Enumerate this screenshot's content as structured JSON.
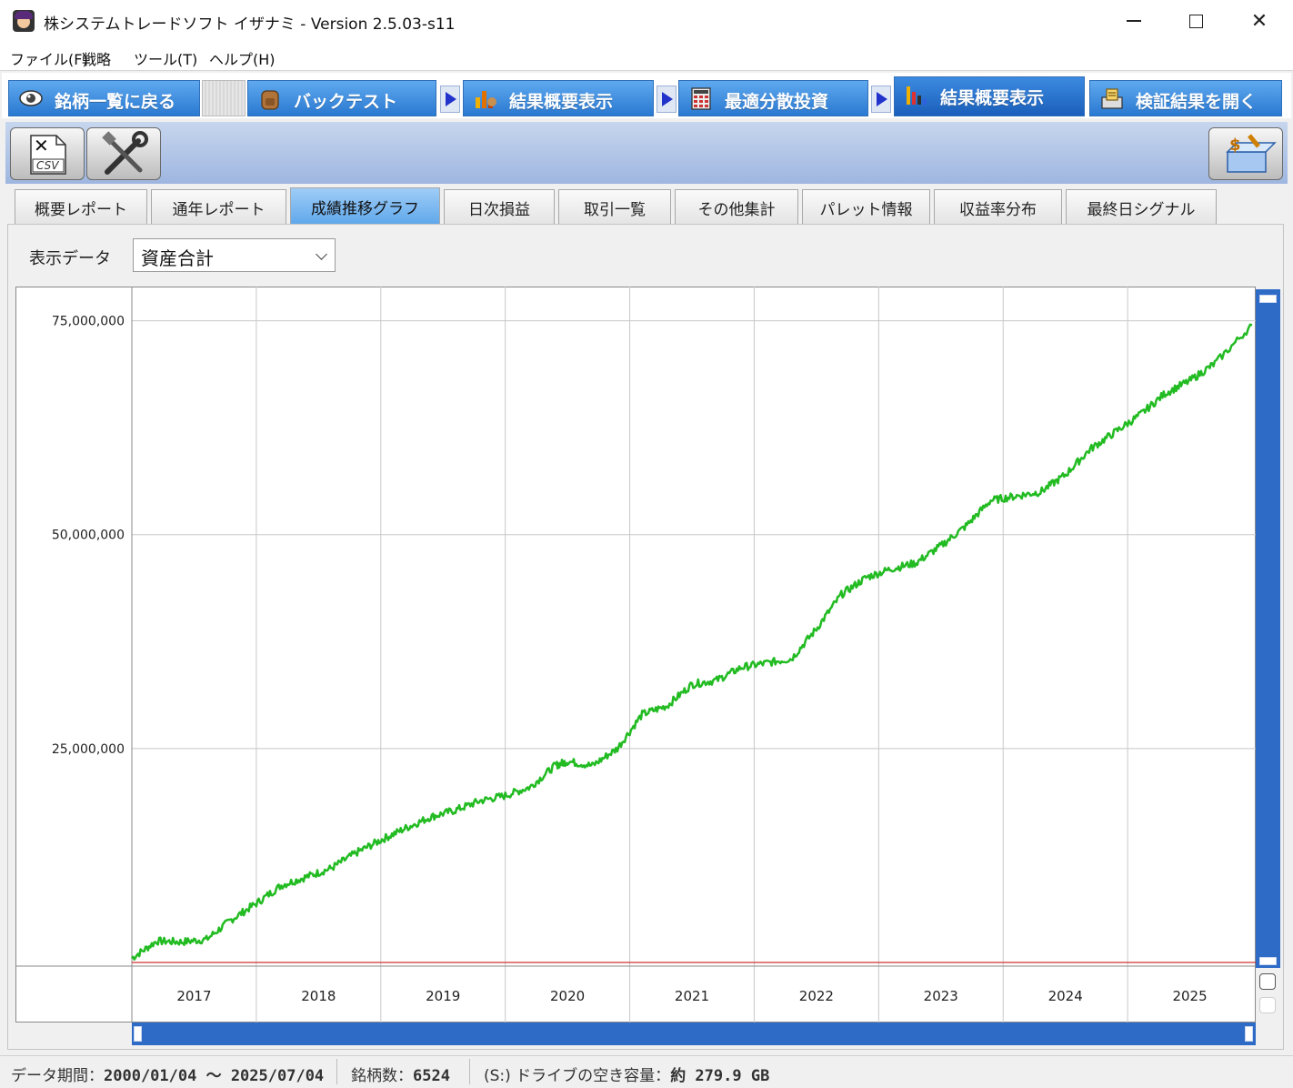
{
  "window": {
    "title": "株システムトレードソフト イザナミ - Version 2.5.03-s11"
  },
  "menu": [
    "ファイル(F)",
    "戦略",
    "ツール(T)",
    "ヘルプ(H)"
  ],
  "main_tabs": [
    {
      "label": "銘柄一覧に戻る",
      "icon": "eye-icon"
    },
    {
      "label": "バックテスト",
      "icon": "backpack-icon"
    },
    {
      "label": "結果概要表示",
      "icon": "bar-chart-icon"
    },
    {
      "label": "最適分散投資",
      "icon": "calculator-icon"
    },
    {
      "label": "結果概要表示",
      "icon": "bar-chart-icon",
      "active": true
    },
    {
      "label": "検証結果を開く",
      "icon": "open-file-icon"
    }
  ],
  "toolbar": {
    "csv_label": "CSV",
    "tools_icon": "tools-icon",
    "money_icon": "money-box-icon"
  },
  "sub_tabs": [
    "概要レポート",
    "通年レポート",
    "成績推移グラフ",
    "日次損益",
    "取引一覧",
    "その他集計",
    "パレット情報",
    "収益率分布",
    "最終日シグナル"
  ],
  "active_sub_tab": "成績推移グラフ",
  "display": {
    "label": "表示データ",
    "selected": "資産合計"
  },
  "colors": {
    "line": "#22bb22",
    "baseline": "#d03030",
    "scroll": "#2e6bc6",
    "tab_blue": "#2a79d1"
  },
  "chart_data": {
    "type": "line",
    "y_ticks": [
      "75,000,000",
      "50,000,000",
      "25,000,000"
    ],
    "y_tick_values": [
      75000000,
      50000000,
      25000000
    ],
    "x_ticks": [
      "2017",
      "2018",
      "2019",
      "2020",
      "2021",
      "2022",
      "2023",
      "2024",
      "2025"
    ],
    "ylim": [
      0,
      79000000
    ],
    "x": [
      2016.5,
      2016.7,
      2016.9,
      2017.1,
      2017.3,
      2017.5,
      2017.7,
      2017.9,
      2018.1,
      2018.3,
      2018.5,
      2018.7,
      2018.9,
      2019.1,
      2019.3,
      2019.5,
      2019.7,
      2019.9,
      2020.0,
      2020.2,
      2020.4,
      2020.6,
      2020.8,
      2021.0,
      2021.2,
      2021.4,
      2021.6,
      2021.8,
      2022.0,
      2022.2,
      2022.4,
      2022.6,
      2022.8,
      2023.0,
      2023.2,
      2023.4,
      2023.6,
      2023.8,
      2024.0,
      2024.2,
      2024.4,
      2024.6,
      2024.8,
      2025.0,
      2025.2,
      2025.5
    ],
    "y": [
      500000,
      2500000,
      2400000,
      2700000,
      5000000,
      6900000,
      9000000,
      10000000,
      11000000,
      12800000,
      14300000,
      15700000,
      17000000,
      17800000,
      18900000,
      19500000,
      20500000,
      23000000,
      23500000,
      23000000,
      25000000,
      29000000,
      30000000,
      32500000,
      33000000,
      34500000,
      35000000,
      35500000,
      39000000,
      43000000,
      45000000,
      46000000,
      46700000,
      48700000,
      51000000,
      54000000,
      54500000,
      55000000,
      57000000,
      60000000,
      62000000,
      64000000,
      66500000,
      68000000,
      70000000,
      74500000
    ],
    "baseline": 0,
    "grid": true,
    "legend": "none"
  },
  "status": {
    "period_label": "データ期間：",
    "period_value": "2000/01/04 〜 2025/07/04",
    "count_label": "銘柄数：",
    "count_value": "6524",
    "drive_label": "(S:) ドライブの空き容量：",
    "drive_value": "約 279.9 GB"
  }
}
